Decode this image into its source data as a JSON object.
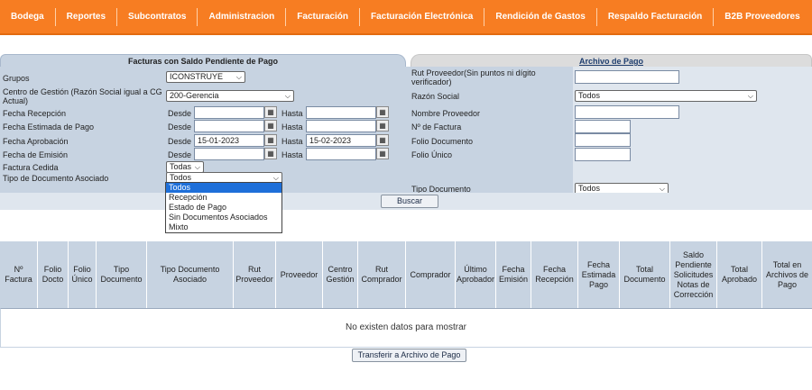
{
  "nav": [
    "Bodega",
    "Reportes",
    "Subcontratos",
    "Administracion",
    "Facturación",
    "Facturación Electrónica",
    "Rendición de Gastos",
    "Respaldo Facturación",
    "B2B Proveedores"
  ],
  "tabs": {
    "left": "Facturas con Saldo Pendiente de Pago",
    "right": "Archivo de Pago"
  },
  "form": {
    "grupos": {
      "label": "Grupos",
      "value": "ICONSTRUYE"
    },
    "centro": {
      "label": "Centro de Gestión (Razón Social igual a CG Actual)",
      "value": "200-Gerencia"
    },
    "fecha_recepcion": {
      "label": "Fecha Recepción"
    },
    "fecha_estimada": {
      "label": "Fecha Estimada de Pago"
    },
    "fecha_aprobacion": {
      "label": "Fecha Aprobación",
      "desde": "15-01-2023",
      "hasta": "15-02-2023"
    },
    "fecha_emision": {
      "label": "Fecha de Emisión"
    },
    "factura_cedida": {
      "label": "Factura Cedida",
      "value": "Todas"
    },
    "tipo_doc_asociado": {
      "label": "Tipo de Documento Asociado",
      "value": "Todos",
      "options": [
        "Todos",
        "Recepción",
        "Estado de Pago",
        "Sin Documentos Asociados",
        "Mixto"
      ]
    },
    "desde_label": "Desde",
    "hasta_label": "Hasta"
  },
  "right_form": {
    "rut": {
      "label": "Rut Proveedor(Sin puntos ni dígito verificador)"
    },
    "razon": {
      "label": "Razón Social",
      "value": "Todos"
    },
    "nombre": {
      "label": "Nombre Proveedor"
    },
    "nfactura": {
      "label": "Nº de Factura"
    },
    "folio_doc": {
      "label": "Folio Documento"
    },
    "folio_unico": {
      "label": "Folio Único"
    },
    "tipo_doc": {
      "label": "Tipo Documento",
      "value": "Todos"
    }
  },
  "buttons": {
    "buscar": "Buscar",
    "transferir": "Transferir a Archivo de Pago"
  },
  "table": {
    "headers": [
      "Nº Factura",
      "Folio Docto",
      "Folio Único",
      "Tipo Documento",
      "Tipo Documento Asociado",
      "Rut Proveedor",
      "Proveedor",
      "Centro Gestión",
      "Rut Comprador",
      "Comprador",
      "Último Aprobador",
      "Fecha Emisión",
      "Fecha Recepción",
      "Fecha Estimada Pago",
      "Total Documento",
      "Saldo Pendiente Solicitudes Notas de Corrección",
      "Total Aprobado",
      "Total en Archivos de Pago"
    ],
    "empty": "No existen datos para mostrar"
  }
}
